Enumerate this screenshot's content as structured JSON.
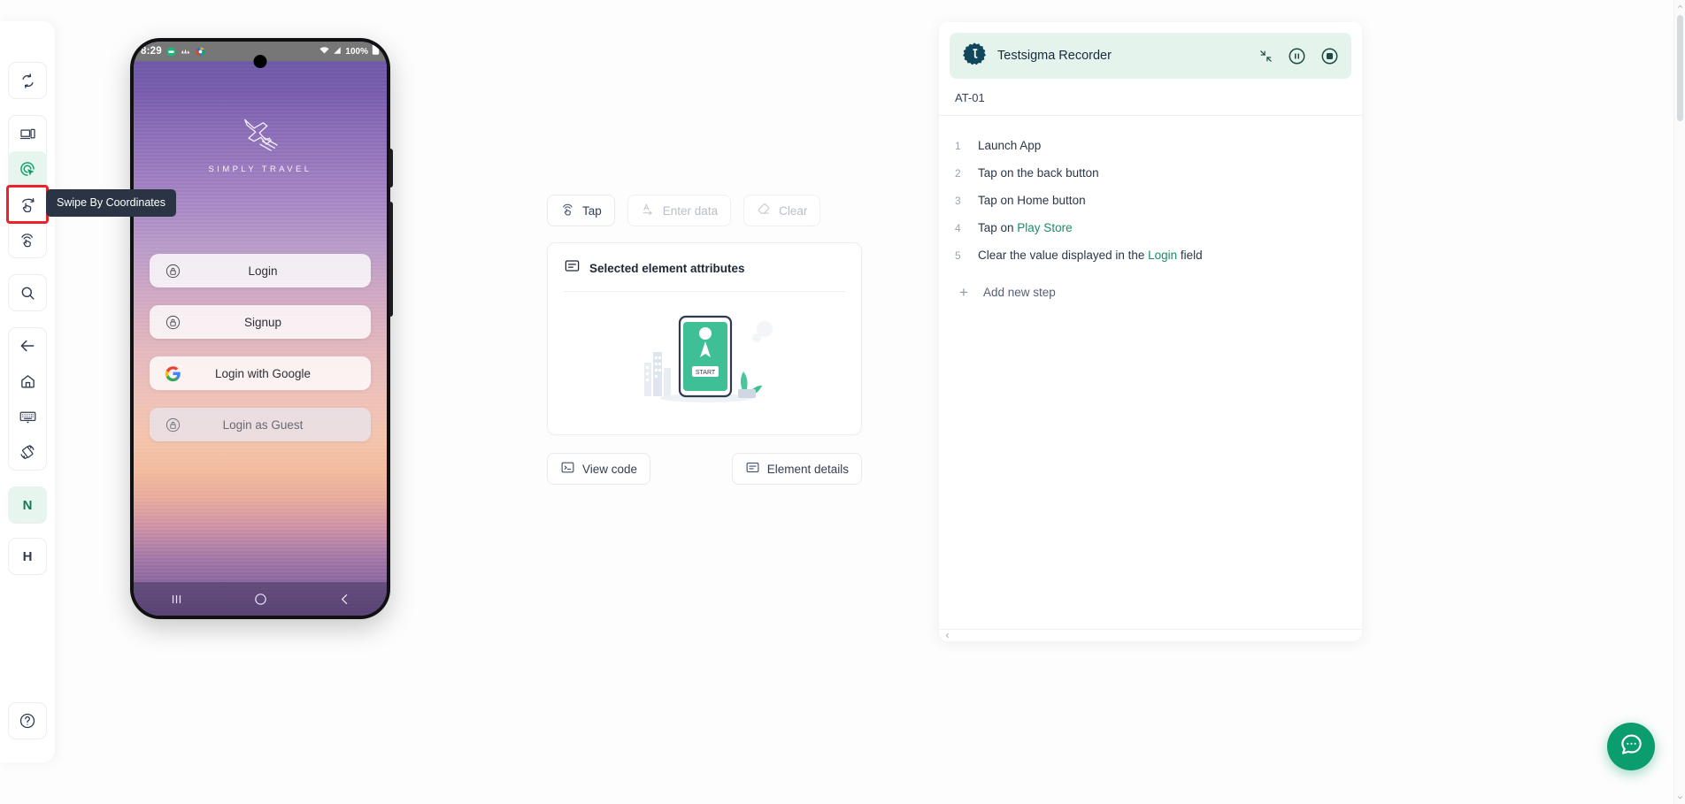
{
  "sidebar": {
    "groups": [
      {
        "items": [
          {
            "name": "refresh",
            "icon": "refresh-icon",
            "state": "default"
          }
        ]
      },
      {
        "items": [
          {
            "name": "device-view",
            "icon": "device-icon",
            "state": "default"
          },
          {
            "name": "tap-mode",
            "icon": "tap-target-icon",
            "state": "active"
          },
          {
            "name": "swipe-by-coordinates",
            "icon": "swipe-coordinates-icon",
            "state": "selected"
          },
          {
            "name": "long-press",
            "icon": "long-press-icon",
            "state": "default"
          }
        ]
      },
      {
        "items": [
          {
            "name": "inspect-search",
            "icon": "search-icon",
            "state": "default"
          }
        ]
      },
      {
        "items": [
          {
            "name": "back-key",
            "icon": "arrow-left-icon",
            "state": "default"
          },
          {
            "name": "home-key",
            "icon": "home-icon",
            "state": "default"
          },
          {
            "name": "keyboard-toggle",
            "icon": "keyboard-icon",
            "state": "default"
          },
          {
            "name": "rotate-screen",
            "icon": "rotate-device-icon",
            "state": "default"
          }
        ]
      },
      {
        "items": [
          {
            "name": "notifications-shortcut",
            "icon": "letter-n",
            "label": "N",
            "state": "letter"
          }
        ]
      },
      {
        "items": [
          {
            "name": "home-shortcut",
            "icon": "letter-h",
            "label": "H",
            "state": "letter"
          }
        ]
      },
      {
        "items": [
          {
            "name": "help",
            "icon": "help-circle-icon",
            "state": "default"
          }
        ]
      }
    ],
    "tooltip": "Swipe By Coordinates"
  },
  "phone": {
    "status": {
      "time": "8:29",
      "icons": [
        "android-app-icon",
        "signal-bars-icon",
        "browser-icon"
      ],
      "wifi": "wifi-icon",
      "signal": "cellular-icon",
      "battery_text": "100%",
      "battery_icon": "battery-full-icon"
    },
    "app": {
      "logo_icon": "airplane-icon",
      "brand": "SIMPLY TRAVEL",
      "buttons": [
        {
          "label": "Login",
          "icon": "lock-circle-icon",
          "style": "light"
        },
        {
          "label": "Signup",
          "icon": "lock-circle-icon",
          "style": "light"
        },
        {
          "label": "Login with Google",
          "icon": "google-g-icon",
          "style": "light"
        },
        {
          "label": "Login as Guest",
          "icon": "lock-circle-icon",
          "style": "guest"
        }
      ]
    },
    "navbar": [
      {
        "name": "recents",
        "icon": "recents-bars-icon"
      },
      {
        "name": "home",
        "icon": "home-circle-icon"
      },
      {
        "name": "back",
        "icon": "back-chevron-icon"
      }
    ]
  },
  "center": {
    "actions": [
      {
        "label": "Tap",
        "icon": "tap-icon",
        "enabled": true
      },
      {
        "label": "Enter data",
        "icon": "enter-data-icon",
        "enabled": false
      },
      {
        "label": "Clear",
        "icon": "eraser-icon",
        "enabled": false
      }
    ],
    "card": {
      "icon": "attributes-icon",
      "title": "Selected element attributes",
      "illustration": "mobile-start-illustration"
    },
    "footer": [
      {
        "label": "View code",
        "icon": "code-icon"
      },
      {
        "label": "Element details",
        "icon": "details-icon"
      }
    ]
  },
  "recorder": {
    "title": "Testsigma Recorder",
    "logo_icon": "testsigma-gear-icon",
    "controls": [
      {
        "name": "collapse",
        "icon": "collapse-icon"
      },
      {
        "name": "pause",
        "icon": "pause-icon"
      },
      {
        "name": "stop",
        "icon": "stop-icon"
      }
    ],
    "test_case": "AT-01",
    "steps": [
      {
        "n": "1",
        "text": "Launch App",
        "param": "",
        "tail": ""
      },
      {
        "n": "2",
        "text": "Tap on the back button",
        "param": "",
        "tail": ""
      },
      {
        "n": "3",
        "text": "Tap on Home button",
        "param": "",
        "tail": ""
      },
      {
        "n": "4",
        "text": "Tap on ",
        "param": "Play Store",
        "tail": ""
      },
      {
        "n": "5",
        "text": "Clear the value displayed in the ",
        "param": "Login",
        "tail": " field"
      }
    ],
    "add_step": {
      "label": "Add new step",
      "icon": "plus-icon"
    }
  },
  "chat": {
    "icon": "chat-bubble-icon",
    "color": "#0c9d6e"
  },
  "colors": {
    "accent_green": "#0f9d68",
    "selection_red": "#e8232a",
    "recorder_header_bg": "#e4f4ec",
    "param_text": "#1c8a6b",
    "tooltip_bg": "#2b3445"
  }
}
